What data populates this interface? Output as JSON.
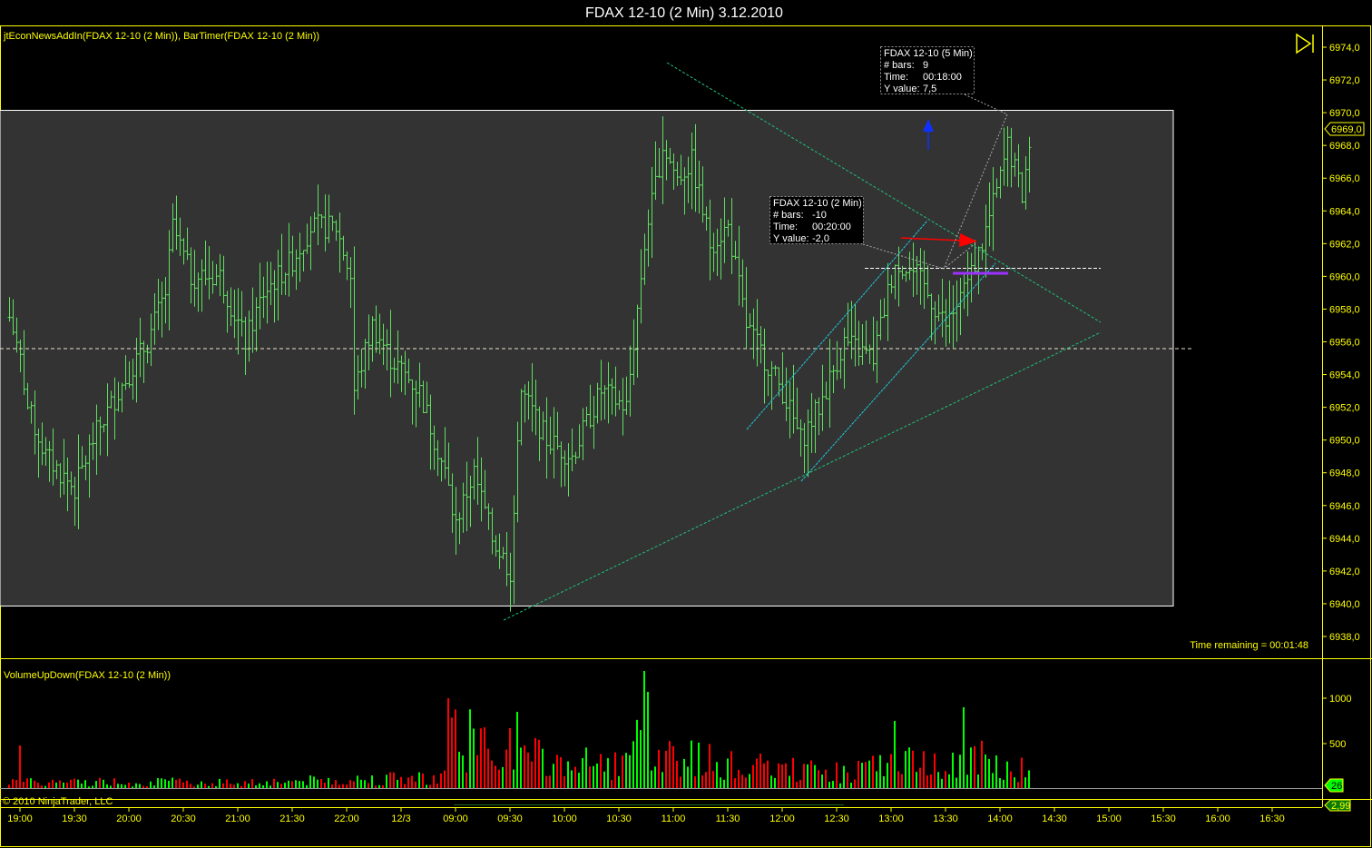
{
  "window": {
    "title": "FDAX 12-10 (2 Min)  3.12.2010"
  },
  "price_panel": {
    "indicators_label": "jtEconNewsAddIn(FDAX 12-10 (2 Min)), BarTimer(FDAX 12-10 (2 Min))",
    "time_remaining": "Time remaining = 00:01:48",
    "last_price_label": "6969,0"
  },
  "volume_panel": {
    "label": "VolumeUpDown(FDAX 12-10 (2 Min))",
    "last_volume_label": "26",
    "secondary_label": "2,99"
  },
  "copyright": "© 2010 NinjaTrader, LLC",
  "tooltips": [
    {
      "title": "FDAX 12-10 (5 Min)",
      "bars_label": "# bars:",
      "bars": "9",
      "time_label": "Time:",
      "time": "00:18:00",
      "y_label": "Y value:",
      "y": "7,5"
    },
    {
      "title": "FDAX 12-10 (2 Min)",
      "bars_label": "# bars:",
      "bars": "-10",
      "time_label": "Time:",
      "time": "00:20:00",
      "y_label": "Y value:",
      "y": "-2,0"
    }
  ],
  "colors": {
    "up": "#00ff00",
    "down": "#ff0000",
    "bar": "#5fe05f",
    "axis": "#ffff00",
    "box": "#333333"
  },
  "chart_data": {
    "type": "ohlc",
    "instrument": "FDAX 12-10",
    "interval": "2 Min",
    "price_ticks": [
      "6974,0",
      "6972,0",
      "6970,0",
      "6968,0",
      "6966,0",
      "6964,0",
      "6962,0",
      "6960,0",
      "6958,0",
      "6956,0",
      "6954,0",
      "6952,0",
      "6950,0",
      "6948,0",
      "6946,0",
      "6944,0",
      "6942,0",
      "6940,0",
      "6938,0"
    ],
    "price_range": [
      6938,
      6974
    ],
    "volume_ticks": [
      "1000",
      "500"
    ],
    "volume_range": [
      0,
      1300
    ],
    "time_ticks": [
      "19:00",
      "19:30",
      "20:00",
      "20:30",
      "21:00",
      "21:30",
      "22:00",
      "12/3",
      "09:00",
      "09:30",
      "10:00",
      "10:30",
      "11:00",
      "11:30",
      "12:00",
      "12:30",
      "13:00",
      "13:30",
      "14:00",
      "14:30",
      "15:00",
      "15:30",
      "16:00",
      "16:30"
    ],
    "close_path": [
      [
        0,
        6957.5
      ],
      [
        3,
        6955
      ],
      [
        5,
        6952
      ],
      [
        10,
        6949
      ],
      [
        18,
        6947
      ],
      [
        23,
        6950
      ],
      [
        30,
        6953
      ],
      [
        38,
        6956
      ],
      [
        43,
        6959
      ],
      [
        45,
        6963
      ],
      [
        50,
        6960
      ],
      [
        58,
        6960
      ],
      [
        65,
        6956
      ],
      [
        70,
        6959
      ],
      [
        78,
        6961
      ],
      [
        83,
        6963
      ],
      [
        90,
        6963
      ],
      [
        94,
        6960
      ],
      [
        95,
        6953
      ],
      [
        100,
        6957
      ],
      [
        105,
        6955
      ],
      [
        113,
        6953
      ],
      [
        120,
        6948
      ],
      [
        123,
        6945
      ],
      [
        128,
        6948
      ],
      [
        133,
        6944
      ],
      [
        138,
        6942
      ],
      [
        141,
        6953
      ],
      [
        148,
        6950
      ],
      [
        155,
        6949
      ],
      [
        163,
        6953
      ],
      [
        170,
        6952
      ],
      [
        175,
        6962
      ],
      [
        180,
        6968
      ],
      [
        184,
        6966
      ],
      [
        188,
        6967
      ],
      [
        193,
        6962
      ],
      [
        198,
        6963
      ],
      [
        203,
        6957
      ],
      [
        208,
        6955
      ],
      [
        213,
        6953
      ],
      [
        218,
        6950
      ],
      [
        223,
        6952
      ],
      [
        230,
        6956
      ],
      [
        238,
        6955
      ],
      [
        244,
        6961
      ],
      [
        250,
        6960
      ],
      [
        258,
        6957
      ],
      [
        263,
        6959
      ],
      [
        268,
        6962
      ],
      [
        273,
        6966
      ],
      [
        275,
        6968
      ],
      [
        279,
        6965
      ],
      [
        281,
        6968
      ]
    ],
    "volume_path": [
      [
        0,
        80
      ],
      [
        30,
        90
      ],
      [
        60,
        80
      ],
      [
        90,
        110
      ],
      [
        120,
        150
      ],
      [
        122,
        650
      ],
      [
        135,
        500
      ],
      [
        150,
        320
      ],
      [
        170,
        300
      ],
      [
        175,
        700
      ],
      [
        180,
        450
      ],
      [
        200,
        280
      ],
      [
        230,
        200
      ],
      [
        244,
        300
      ],
      [
        263,
        400
      ],
      [
        275,
        300
      ],
      [
        281,
        200
      ]
    ],
    "volume_spikes": [
      [
        3,
        480
      ],
      [
        121,
        1000
      ],
      [
        140,
        850
      ],
      [
        175,
        1300
      ],
      [
        176,
        1070
      ],
      [
        244,
        750
      ],
      [
        263,
        900
      ]
    ],
    "reference_lines": {
      "box_top": 6970.0,
      "box_bottom": 6940.0,
      "horizontal": 6955.6,
      "last_price": 6969.0
    }
  }
}
